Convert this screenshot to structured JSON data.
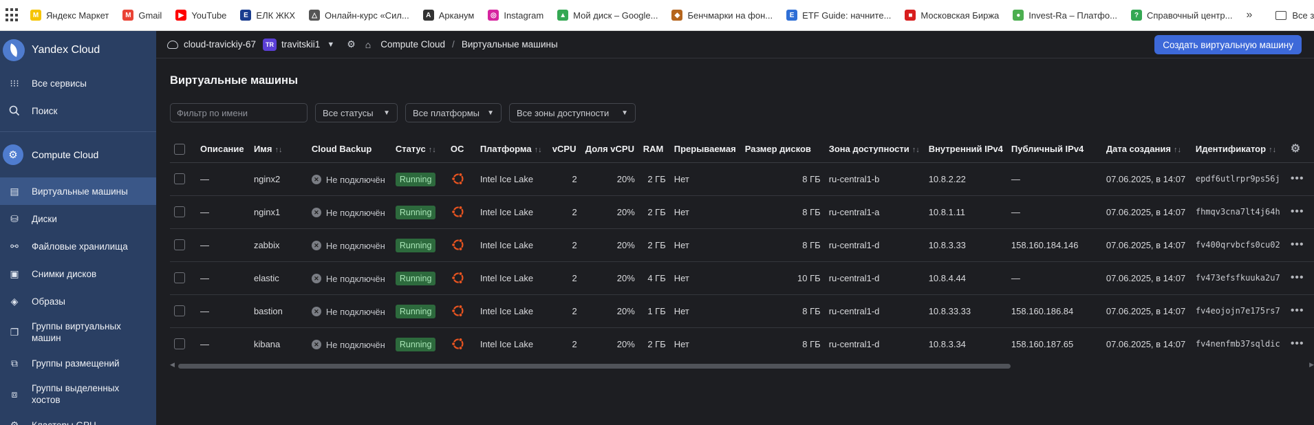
{
  "bookmarks": [
    {
      "label": "Яндекс Маркет",
      "icon": "yandex-market-icon",
      "color": "#f5c400",
      "glyph": "M"
    },
    {
      "label": "Gmail",
      "icon": "gmail-icon",
      "color": "#ea4335",
      "glyph": "M"
    },
    {
      "label": "YouTube",
      "icon": "youtube-icon",
      "color": "#ff0000",
      "glyph": "▶"
    },
    {
      "label": "ЕЛК ЖКХ",
      "icon": "elk-icon",
      "color": "#1a3d8f",
      "glyph": "Е"
    },
    {
      "label": "Онлайн-курс «Сил...",
      "icon": "course-icon",
      "color": "#555555",
      "glyph": "△"
    },
    {
      "label": "Арканум",
      "icon": "arcanum-icon",
      "color": "#333333",
      "glyph": "A"
    },
    {
      "label": "Instagram",
      "icon": "instagram-icon",
      "color": "#d6249f",
      "glyph": "◎"
    },
    {
      "label": "Мой диск – Google...",
      "icon": "google-drive-icon",
      "color": "#34a853",
      "glyph": "▲"
    },
    {
      "label": "Бенчмарки на фон...",
      "icon": "benchmark-icon",
      "color": "#b5651d",
      "glyph": "◆"
    },
    {
      "label": "ETF Guide: начните...",
      "icon": "etf-icon",
      "color": "#2f6fd6",
      "glyph": "E"
    },
    {
      "label": "Московская Биржа",
      "icon": "moex-icon",
      "color": "#d81e1e",
      "glyph": "■"
    },
    {
      "label": "Invest-Ra – Платфо...",
      "icon": "invest-icon",
      "color": "#4caf50",
      "glyph": "●"
    },
    {
      "label": "Справочный центр...",
      "icon": "help-center-icon",
      "color": "#34a853",
      "glyph": "?"
    }
  ],
  "bookmarks_all": "Все закладки",
  "sidebar": {
    "brand": "Yandex Cloud",
    "all_services": "Все сервисы",
    "search": "Поиск",
    "service": "Compute Cloud",
    "items": [
      {
        "label": "Виртуальные машины",
        "icon": "vm-icon",
        "glyph": "▤"
      },
      {
        "label": "Диски",
        "icon": "disk-icon",
        "glyph": "⛁"
      },
      {
        "label": "Файловые хранилища",
        "icon": "file-storage-icon",
        "glyph": "⚯"
      },
      {
        "label": "Снимки дисков",
        "icon": "snapshot-icon",
        "glyph": "▣"
      },
      {
        "label": "Образы",
        "icon": "image-icon",
        "glyph": "◈"
      },
      {
        "label": "Группы виртуальных машин",
        "icon": "vm-group-icon",
        "glyph": "❐"
      },
      {
        "label": "Группы размещений",
        "icon": "placement-group-icon",
        "glyph": "⧉"
      },
      {
        "label": "Группы выделенных хостов",
        "icon": "host-group-icon",
        "glyph": "⧈"
      },
      {
        "label": "Кластеры GPU",
        "icon": "gpu-cluster-icon",
        "glyph": "⚙"
      }
    ]
  },
  "topbar": {
    "cloud": "cloud-travickiy-67",
    "folder_badge": "TR",
    "folder": "travitskii1",
    "breadcrumb_service": "Compute Cloud",
    "breadcrumb_page": "Виртуальные машины",
    "create_button": "Создать виртуальную машину"
  },
  "page": {
    "title": "Виртуальные машины",
    "filter_placeholder": "Фильтр по имени",
    "status_filter": "Все статусы",
    "platform_filter": "Все платформы",
    "zone_filter": "Все зоны доступности"
  },
  "table": {
    "headers": {
      "description": "Описание",
      "name": "Имя",
      "backup": "Cloud Backup",
      "status": "Статус",
      "os": "ОС",
      "platform": "Платформа",
      "vcpu": "vCPU",
      "vcpu_share": "Доля vCPU",
      "ram": "RAM",
      "preemptible": "Прерываемая",
      "disk_size": "Размер дисков",
      "zone": "Зона доступности",
      "ipv4_internal": "Внутренний IPv4",
      "ipv4_public": "Публичный IPv4",
      "created": "Дата создания",
      "id": "Идентификатор"
    },
    "rows": [
      {
        "description": "—",
        "name": "nginx2",
        "backup": "Не подключён",
        "status": "Running",
        "platform": "Intel Ice Lake",
        "vcpu": "2",
        "vcpu_share": "20%",
        "ram": "2 ГБ",
        "preemptible": "Нет",
        "disk_size": "8 ГБ",
        "zone": "ru-central1-b",
        "ipv4_internal": "10.8.2.22",
        "ipv4_public": "—",
        "created": "07.06.2025, в 14:07",
        "id": "epdf6utlrpr9ps56j"
      },
      {
        "description": "—",
        "name": "nginx1",
        "backup": "Не подключён",
        "status": "Running",
        "platform": "Intel Ice Lake",
        "vcpu": "2",
        "vcpu_share": "20%",
        "ram": "2 ГБ",
        "preemptible": "Нет",
        "disk_size": "8 ГБ",
        "zone": "ru-central1-a",
        "ipv4_internal": "10.8.1.11",
        "ipv4_public": "—",
        "created": "07.06.2025, в 14:07",
        "id": "fhmqv3cna7lt4j64h"
      },
      {
        "description": "—",
        "name": "zabbix",
        "backup": "Не подключён",
        "status": "Running",
        "platform": "Intel Ice Lake",
        "vcpu": "2",
        "vcpu_share": "20%",
        "ram": "2 ГБ",
        "preemptible": "Нет",
        "disk_size": "8 ГБ",
        "zone": "ru-central1-d",
        "ipv4_internal": "10.8.3.33",
        "ipv4_public": "158.160.184.146",
        "created": "07.06.2025, в 14:07",
        "id": "fv400qrvbcfs0cu02"
      },
      {
        "description": "—",
        "name": "elastic",
        "backup": "Не подключён",
        "status": "Running",
        "platform": "Intel Ice Lake",
        "vcpu": "2",
        "vcpu_share": "20%",
        "ram": "4 ГБ",
        "preemptible": "Нет",
        "disk_size": "10 ГБ",
        "zone": "ru-central1-d",
        "ipv4_internal": "10.8.4.44",
        "ipv4_public": "—",
        "created": "07.06.2025, в 14:07",
        "id": "fv473efsfkuuka2u7"
      },
      {
        "description": "—",
        "name": "bastion",
        "backup": "Не подключён",
        "status": "Running",
        "platform": "Intel Ice Lake",
        "vcpu": "2",
        "vcpu_share": "20%",
        "ram": "1 ГБ",
        "preemptible": "Нет",
        "disk_size": "8 ГБ",
        "zone": "ru-central1-d",
        "ipv4_internal": "10.8.33.33",
        "ipv4_public": "158.160.186.84",
        "created": "07.06.2025, в 14:07",
        "id": "fv4eojojn7e175rs7"
      },
      {
        "description": "—",
        "name": "kibana",
        "backup": "Не подключён",
        "status": "Running",
        "platform": "Intel Ice Lake",
        "vcpu": "2",
        "vcpu_share": "20%",
        "ram": "2 ГБ",
        "preemptible": "Нет",
        "disk_size": "8 ГБ",
        "zone": "ru-central1-d",
        "ipv4_internal": "10.8.3.34",
        "ipv4_public": "158.160.187.65",
        "created": "07.06.2025, в 14:07",
        "id": "fv4nenfmb37sqldic"
      }
    ]
  },
  "colors": {
    "sidebar_bg": "#2a3f63",
    "accent": "#3d69d9",
    "status_running": "#2d6a3d",
    "ubuntu": "#e95420"
  }
}
